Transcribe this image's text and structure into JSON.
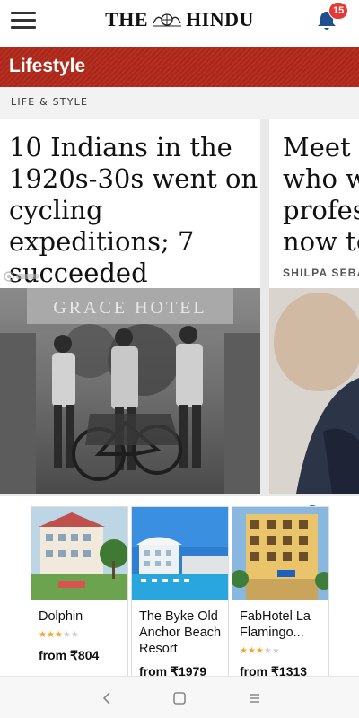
{
  "header": {
    "logo_left": "THE",
    "logo_right": "HINDU",
    "notification_count": "15"
  },
  "section": {
    "title": "Lifestyle",
    "category": "LIFE & STYLE"
  },
  "cards": [
    {
      "headline": [
        "10 Indians in the",
        "1920s-30s went on",
        "cycling",
        "expeditions; 7",
        "succeeded"
      ],
      "photo_sign": "GRACE HOTEL"
    },
    {
      "headline": [
        "Meet R",
        "who w",
        "profes",
        "now te"
      ],
      "byline": "SHILPA SEBA"
    }
  ],
  "ads": [
    {
      "name": "Dolphin",
      "stars": "★★★☆☆",
      "price": "from ₹804"
    },
    {
      "name": "The Byke Old Anchor Beach Resort",
      "price": "from ₹1979"
    },
    {
      "name": "FabHotel La Flamingo...",
      "stars": "★★★☆☆",
      "price": "from ₹1313"
    }
  ],
  "ad_choices_icon": "info-icon",
  "colors": {
    "brand_red": "#b0281a",
    "badge_red": "#e53935",
    "star_orange": "#f5a623",
    "nav_icon": "#888888"
  }
}
